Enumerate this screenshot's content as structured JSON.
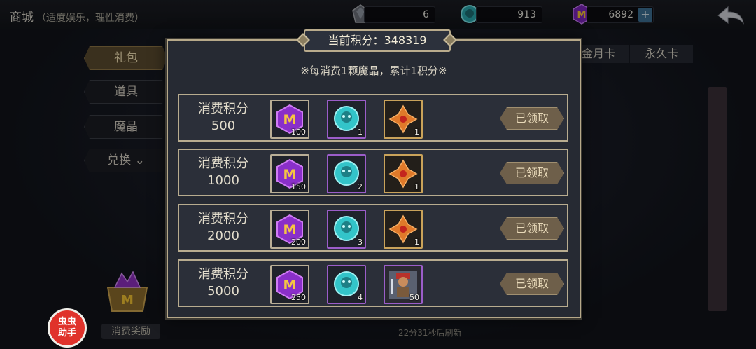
{
  "header": {
    "title": "商城",
    "subtitle": "（适度娱乐，理性消费）",
    "resources": [
      {
        "icon": "gray-crystal-icon",
        "value": "6"
      },
      {
        "icon": "cyan-coin-icon",
        "value": "913"
      },
      {
        "icon": "purple-gem-icon",
        "value": "6892"
      }
    ],
    "plus": "+"
  },
  "sidebar": {
    "tabs": [
      "礼包",
      "道具",
      "魔晶",
      "兑换 ⌄"
    ]
  },
  "top_tabs": [
    "金月卡",
    "永久卡"
  ],
  "bottom": {
    "reward_label": "消费奖励",
    "helper_label": "虫虫\n助手",
    "refresh_text": "22分31秒后刷新"
  },
  "modal": {
    "score_label": "当前积分：348319",
    "rule_note": "※每消费1颗魔晶，累计1积分※",
    "tiers": [
      {
        "label": "消费积分",
        "points": "500",
        "gem_qty": "100",
        "coin_qty": "1",
        "third_icon": "orange-cross-relic-icon",
        "third_qty": "1",
        "button": "已领取"
      },
      {
        "label": "消费积分",
        "points": "1000",
        "gem_qty": "150",
        "coin_qty": "2",
        "third_icon": "orange-cross-relic-icon",
        "third_qty": "1",
        "button": "已领取"
      },
      {
        "label": "消费积分",
        "points": "2000",
        "gem_qty": "200",
        "coin_qty": "3",
        "third_icon": "orange-cross-relic-icon",
        "third_qty": "1",
        "button": "已领取"
      },
      {
        "label": "消费积分",
        "points": "5000",
        "gem_qty": "250",
        "coin_qty": "4",
        "third_icon": "warrior-hero-card-icon",
        "third_qty": "50",
        "button": "已领取"
      }
    ]
  },
  "colors": {
    "gold_border": "#b8ac8f",
    "gem_purple": "#8a2fc9",
    "coin_cyan": "#33c4c9",
    "relic_orange": "#e07a2a",
    "claimed_button": "#6e5f4a"
  }
}
